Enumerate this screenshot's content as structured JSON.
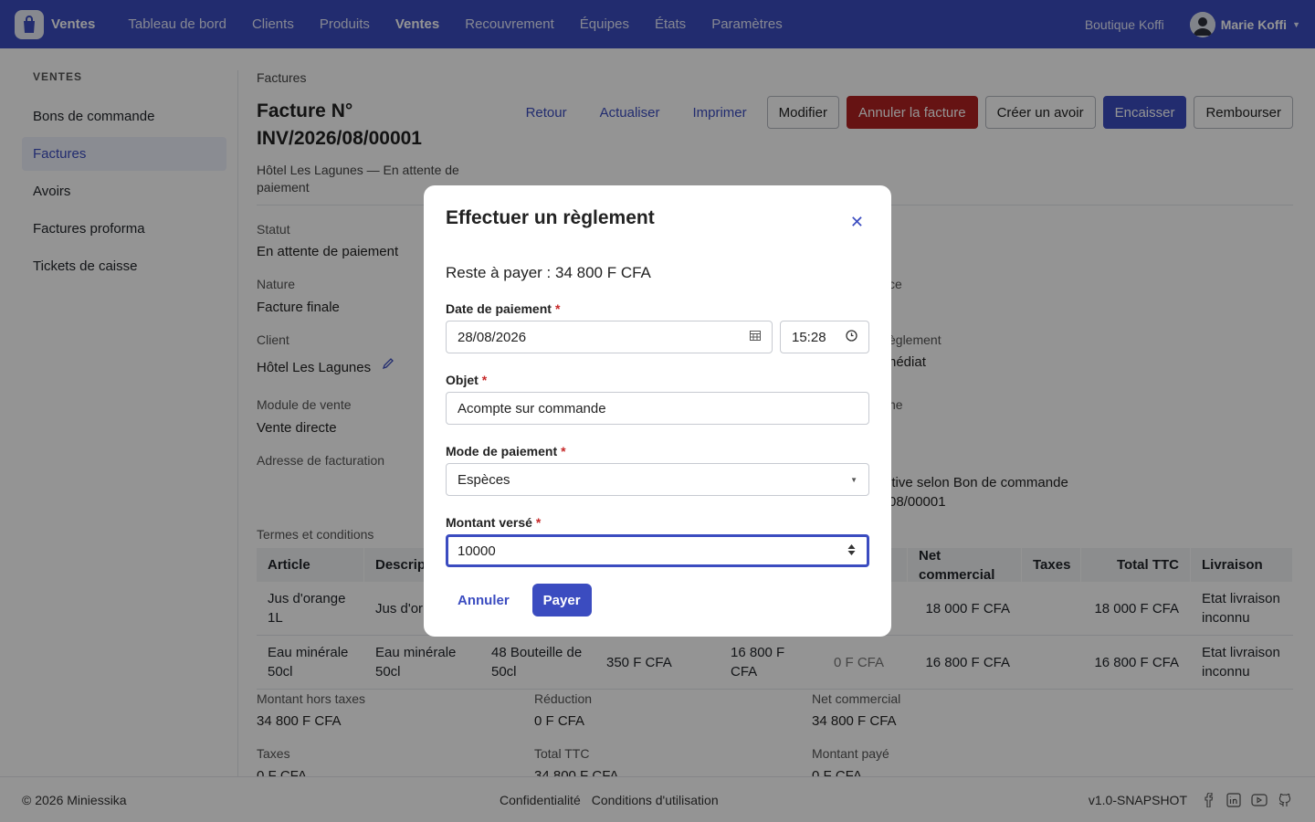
{
  "header": {
    "brand": "Ventes",
    "nav": [
      "Tableau de bord",
      "Clients",
      "Produits",
      "Ventes",
      "Recouvrement",
      "Équipes",
      "États",
      "Paramètres"
    ],
    "shop": "Boutique Koffi",
    "user": "Marie Koffi"
  },
  "sidebar": {
    "heading": "VENTES",
    "items": [
      "Bons de commande",
      "Factures",
      "Avoirs",
      "Factures proforma",
      "Tickets de caisse"
    ]
  },
  "page": {
    "breadcrumb": "Factures",
    "title": "Facture N° INV/2026/08/00001",
    "subtitle": "Hôtel Les Lagunes — En attente de paiement",
    "actions": {
      "back": "Retour",
      "refresh": "Actualiser",
      "print": "Imprimer",
      "edit": "Modifier",
      "cancel_invoice": "Annuler la facture",
      "credit_note": "Créer un avoir",
      "collect": "Encaisser",
      "refund": "Rembourser"
    },
    "fields": {
      "status_label": "Statut",
      "status_value": "En attente de paiement",
      "nature_label": "Nature",
      "nature_value": "Facture finale",
      "client_label": "Client",
      "client_value": "Hôtel Les Lagunes",
      "module_label": "Module de vente",
      "module_value": "Vente directe",
      "billing_label": "Adresse de facturation",
      "right_label_1": "ce",
      "right_label_2": "èglement",
      "right_value_2": "nédiat",
      "right_label_3": "ne",
      "right_note_1": "itive selon Bon de commande",
      "right_note_2": "08/00001",
      "terms_label": "Termes et conditions"
    },
    "table": {
      "headers": [
        "Article",
        "Descrip",
        "",
        "",
        "",
        "",
        "Net commercial",
        "Taxes",
        "Total TTC",
        "Livraison"
      ],
      "rows": [
        [
          "Jus d'orange 1L",
          "Jus d'or 1L",
          "",
          "",
          "",
          "",
          "18 000 F CFA",
          "",
          "18 000 F CFA",
          "Etat livraison inconnu"
        ],
        [
          "Eau minérale 50cl",
          "Eau minérale 50cl",
          "48 Bouteille de 50cl",
          "350 F CFA",
          "16 800 F CFA",
          "0 F CFA",
          "16 800 F CFA",
          "",
          "16 800 F CFA",
          "Etat livraison inconnu"
        ]
      ]
    },
    "totals": {
      "ht_label": "Montant hors taxes",
      "ht_value": "34 800 F CFA",
      "discount_label": "Réduction",
      "discount_value": "0 F CFA",
      "net_label": "Net commercial",
      "net_value": "34 800 F CFA",
      "taxes_label": "Taxes",
      "taxes_value": "0 F CFA",
      "ttc_label": "Total TTC",
      "ttc_value": "34 800 F CFA",
      "paid_label": "Montant payé",
      "paid_value": "0 F CFA"
    }
  },
  "modal": {
    "title": "Effectuer un règlement",
    "remaining": "Reste à payer : 34 800 F CFA",
    "date_label": "Date de paiement",
    "date_value": "28/08/2026",
    "time_value": "15:28",
    "subject_label": "Objet",
    "subject_value": "Acompte sur commande",
    "method_label": "Mode de paiement",
    "method_value": "Espèces",
    "amount_label": "Montant versé",
    "amount_value": "10000",
    "required_mark": "*",
    "cancel": "Annuler",
    "pay": "Payer"
  },
  "footer": {
    "copyright": "© 2026 Miniessika",
    "privacy": "Confidentialité",
    "terms": "Conditions d'utilisation",
    "version": "v1.0-SNAPSHOT"
  },
  "colors": {
    "primary": "#3b4cc0",
    "danger": "#b02222",
    "overlay": "rgba(0,0,0,0.42)"
  },
  "icons": [
    "shopping-bag-icon",
    "calendar-icon",
    "clock-icon",
    "close-icon",
    "pencil-icon",
    "facebook-icon",
    "linkedin-icon",
    "youtube-icon",
    "github-icon"
  ]
}
